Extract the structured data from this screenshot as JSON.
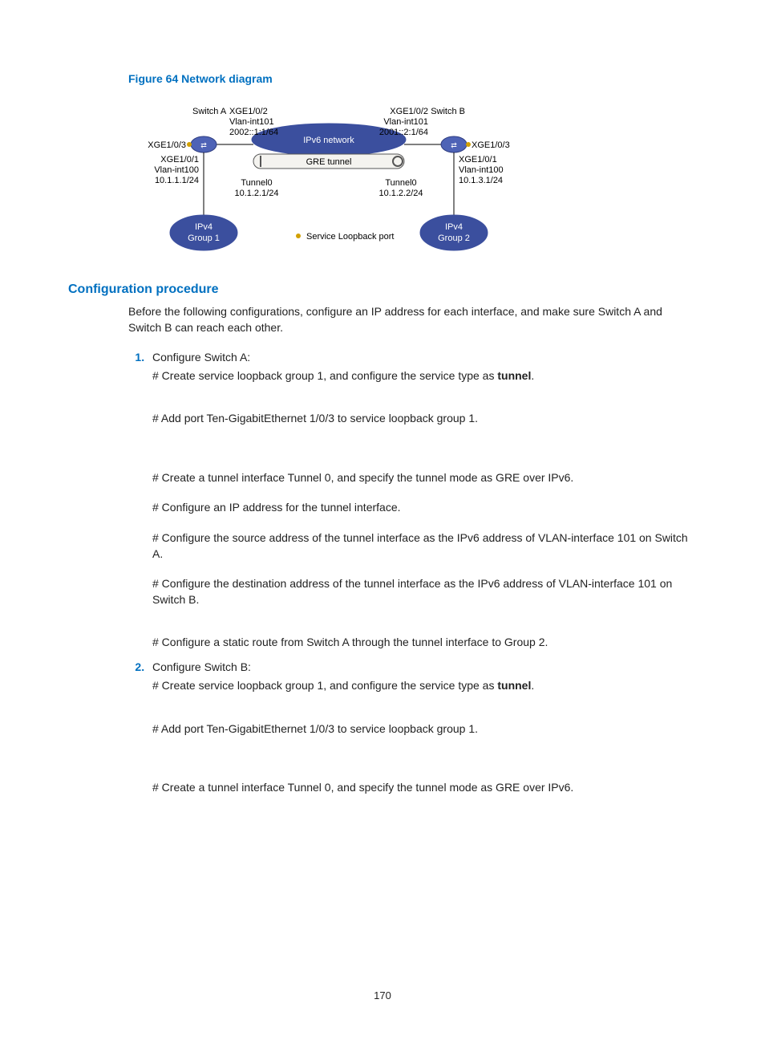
{
  "figure": {
    "caption": "Figure 64 Network diagram",
    "left": {
      "switch": "Switch A",
      "iface1_port": "XGE1/0/2",
      "iface1_vlan": "Vlan-int101",
      "iface1_addr": "2002::1:1/64",
      "loop_port": "XGE1/0/3",
      "iface2_port": "XGE1/0/1",
      "iface2_vlan": "Vlan-int100",
      "iface2_addr": "10.1.1.1/24",
      "tunnel_name": "Tunnel0",
      "tunnel_addr": "10.1.2.1/24",
      "group": "IPv4\nGroup 1"
    },
    "right": {
      "switch": "Switch B",
      "iface1_port": "XGE1/0/2",
      "iface1_vlan": "Vlan-int101",
      "iface1_addr": "2001::2:1/64",
      "loop_port": "XGE1/0/3",
      "iface2_port": "XGE1/0/1",
      "iface2_vlan": "Vlan-int100",
      "iface2_addr": "10.1.3.1/24",
      "tunnel_name": "Tunnel0",
      "tunnel_addr": "10.1.2.2/24",
      "group": "IPv4\nGroup 2"
    },
    "center": {
      "net_label": "IPv6 network",
      "tunnel_label": "GRE tunnel",
      "legend": "Service Loopback port"
    }
  },
  "section_heading": "Configuration procedure",
  "intro": "Before the following configurations, configure an IP address for each interface, and make sure Switch A and Switch B can reach each other.",
  "bold_tunnel": "tunnel",
  "steps": [
    {
      "head": "Configure Switch A:",
      "sub": [
        {
          "pre": "# Create service loopback group 1, and configure the service type as ",
          "bold": "tunnel",
          "post": "."
        },
        "# Add port Ten-GigabitEthernet 1/0/3 to service loopback group 1.",
        "# Create a tunnel interface Tunnel 0, and specify the tunnel mode as GRE over IPv6.",
        "# Configure an IP address for the tunnel interface.",
        "# Configure the source address of the tunnel interface as the IPv6 address of VLAN-interface 101 on Switch A.",
        "# Configure the destination address of the tunnel interface as the IPv6 address of VLAN-interface 101 on Switch B.",
        "# Configure a static route from Switch A through the tunnel interface to Group 2."
      ]
    },
    {
      "head": "Configure Switch B:",
      "sub": [
        {
          "pre": "# Create service loopback group 1, and configure the service type as ",
          "bold": "tunnel",
          "post": "."
        },
        "# Add port Ten-GigabitEthernet 1/0/3 to service loopback group 1.",
        "# Create a tunnel interface Tunnel 0, and specify the tunnel mode as GRE over IPv6."
      ]
    }
  ],
  "page_num": "170"
}
